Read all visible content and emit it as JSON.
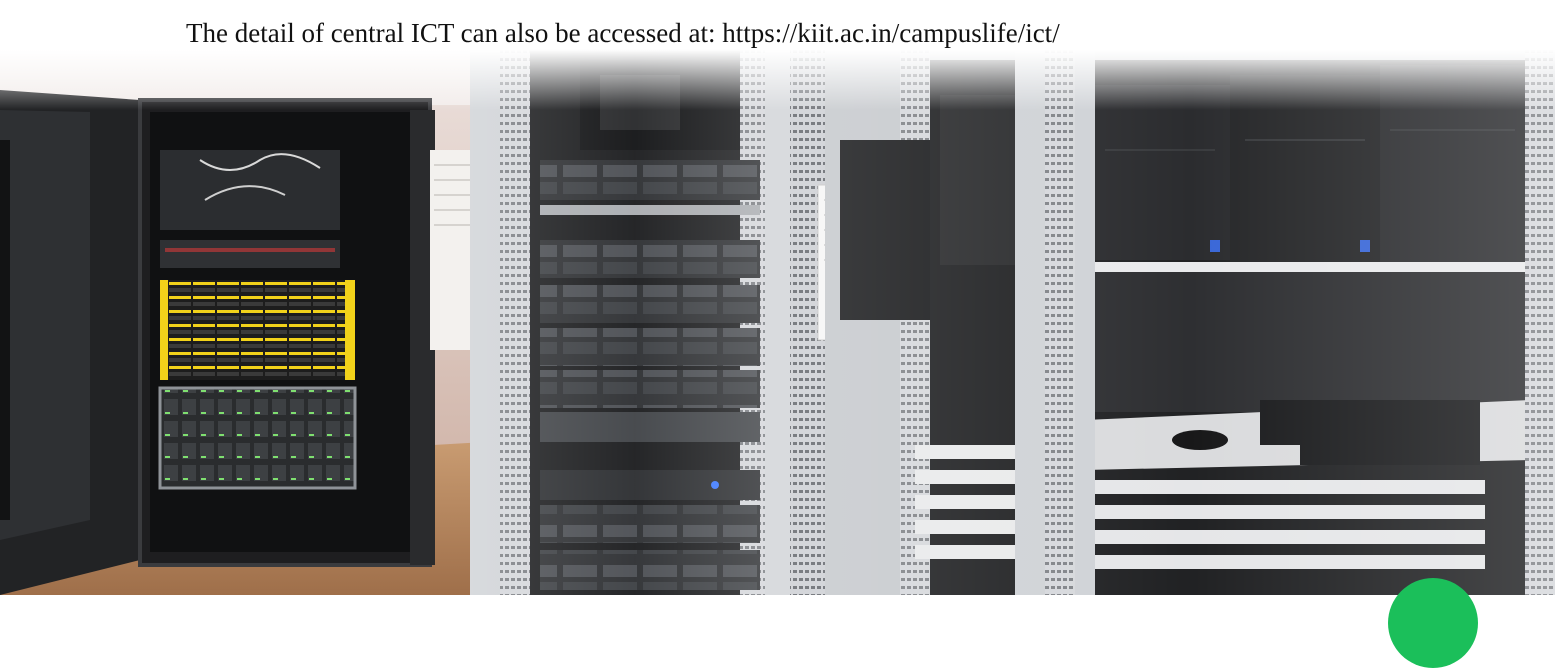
{
  "caption": {
    "text": "The detail of central ICT can also be accessed at: https://kiit.ac.in/campuslife/ict/"
  },
  "photo": {
    "subject": "server room racks"
  },
  "colors": {
    "badge": "#1bbf5a",
    "floor": "#b98a62",
    "rack_dark": "#1e1e20",
    "rack_frame": "#c9cbcf",
    "yellow_bezel": "#f2d21a"
  }
}
